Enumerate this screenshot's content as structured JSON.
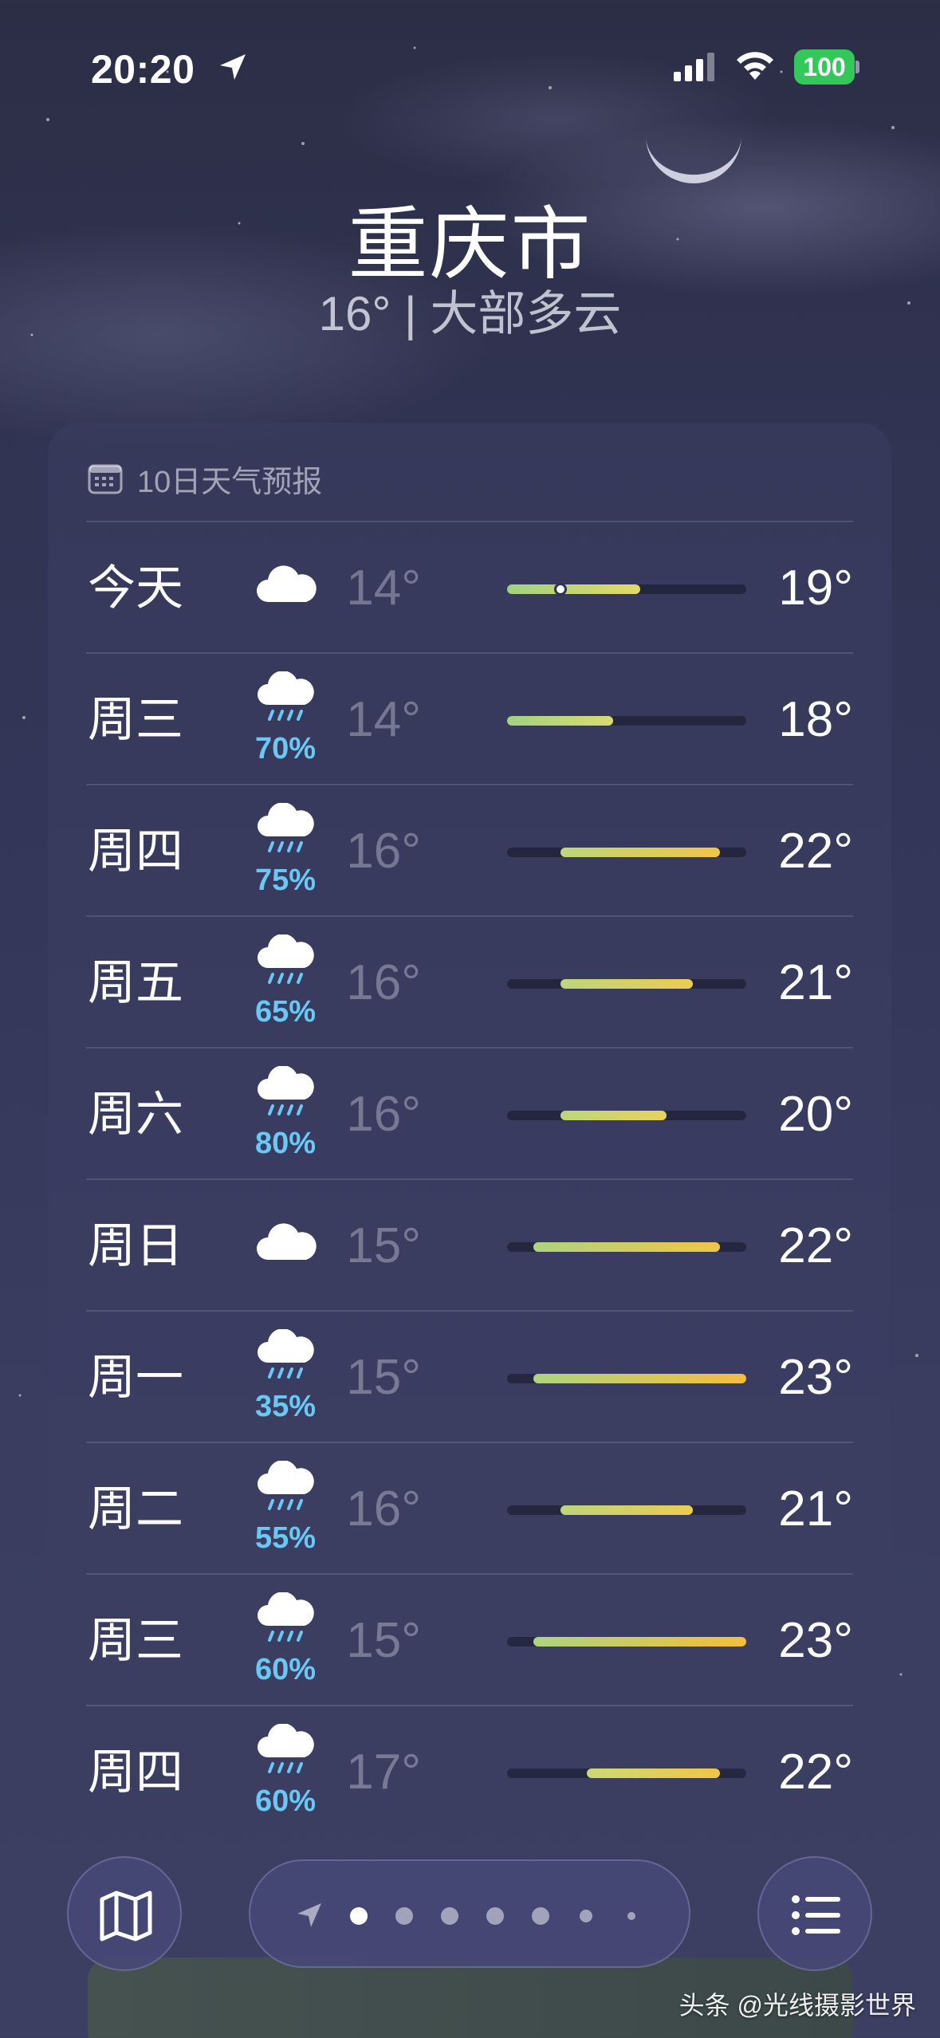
{
  "status_bar": {
    "time": "20:20",
    "battery": "100"
  },
  "header": {
    "city": "重庆市",
    "subtitle": "16° | 大部多云"
  },
  "forecast": {
    "title": "10日天气预报",
    "days": [
      {
        "day": "今天",
        "icon": "cloud-icon",
        "precip": "",
        "low": "14°",
        "high": "19°"
      },
      {
        "day": "周三",
        "icon": "cloud-rain-icon",
        "precip": "70%",
        "low": "14°",
        "high": "18°"
      },
      {
        "day": "周四",
        "icon": "cloud-rain-icon",
        "precip": "75%",
        "low": "16°",
        "high": "22°"
      },
      {
        "day": "周五",
        "icon": "cloud-rain-icon",
        "precip": "65%",
        "low": "16°",
        "high": "21°"
      },
      {
        "day": "周六",
        "icon": "cloud-rain-icon",
        "precip": "80%",
        "low": "16°",
        "high": "20°"
      },
      {
        "day": "周日",
        "icon": "cloud-icon",
        "precip": "",
        "low": "15°",
        "high": "22°"
      },
      {
        "day": "周一",
        "icon": "cloud-rain-icon",
        "precip": "35%",
        "low": "15°",
        "high": "23°"
      },
      {
        "day": "周二",
        "icon": "cloud-rain-icon",
        "precip": "55%",
        "low": "16°",
        "high": "21°"
      },
      {
        "day": "周三",
        "icon": "cloud-rain-icon",
        "precip": "60%",
        "low": "15°",
        "high": "23°"
      },
      {
        "day": "周四",
        "icon": "cloud-rain-icon",
        "precip": "60%",
        "low": "17°",
        "high": "22°"
      }
    ]
  },
  "toolbar": {
    "pages": 7,
    "active_page": 1
  },
  "watermark": "头条 @光线摄影世界"
}
